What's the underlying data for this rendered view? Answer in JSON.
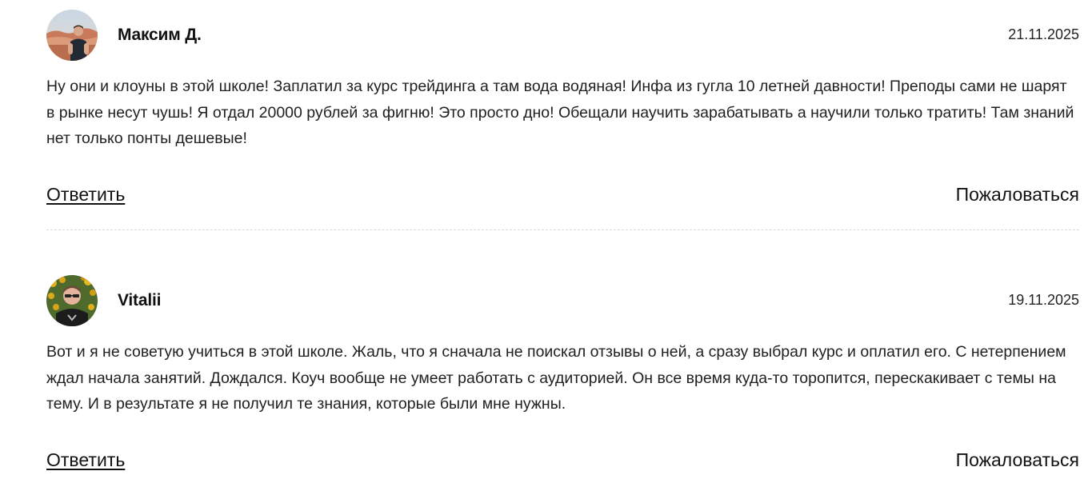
{
  "comments": [
    {
      "author": "Максим Д.",
      "date": "21.11.2025",
      "text": "Ну они и клоуны в этой школе! Заплатил за курс трейдинга а там вода водяная! Инфа из гугла 10 летней давности! Преподы сами не шарят в рынке несут чушь! Я отдал 20000 рублей за фигню! Это просто дно! Обещали научить зарабатывать а научили только тратить! Там знаний нет только понты дешевые!",
      "reply_label": "Ответить",
      "report_label": "Пожаловаться",
      "avatar_icon": "user-photo-avatar-icon"
    },
    {
      "author": "Vitalii",
      "date": "19.11.2025",
      "text": "Вот и я не советую учиться в этой школе. Жаль, что я сначала не поискал отзывы о ней, а сразу выбрал курс и оплатил его. С нетерпением ждал начала занятий. Дождался. Коуч вообще не умеет работать с аудиторией. Он все время куда-то торопится, перескакивает с темы на тему. И в результате я не получил те знания, которые были мне нужны.",
      "reply_label": "Ответить",
      "report_label": "Пожаловаться",
      "avatar_icon": "user-photo-avatar-icon"
    }
  ]
}
